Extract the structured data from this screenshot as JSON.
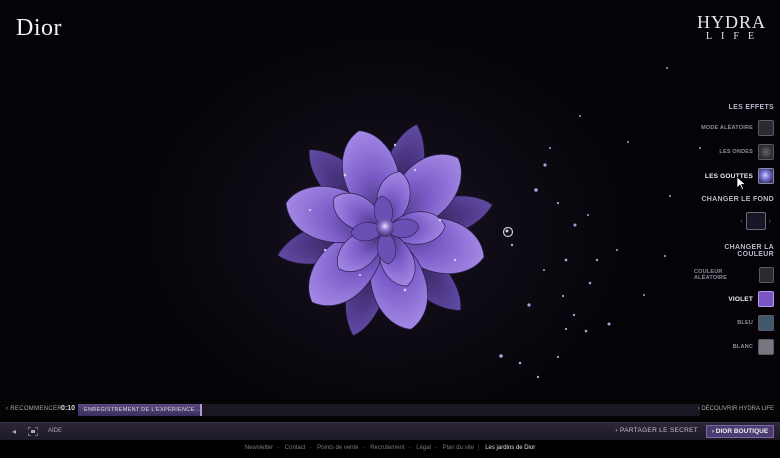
{
  "brand": {
    "logo": "Dior",
    "hydra_line1": "HYDRA",
    "hydra_line2": "LIFE"
  },
  "effects": {
    "title": "LES EFFETS",
    "items": [
      {
        "label": "MODE ALÉATOIRE",
        "active": false
      },
      {
        "label": "LES ONDES",
        "active": false
      },
      {
        "label": "LES GOUTTES",
        "active": true
      }
    ]
  },
  "background": {
    "title": "CHANGER LE FOND"
  },
  "colors": {
    "title": "CHANGER LA COULEUR",
    "items": [
      {
        "label": "COULEUR ALÉATOIRE",
        "active": false
      },
      {
        "label": "VIOLET",
        "active": true
      },
      {
        "label": "BLEU",
        "active": false
      },
      {
        "label": "BLANC",
        "active": false
      }
    ]
  },
  "timebar": {
    "restart_label": "RECOMMENCER",
    "time": "0:10",
    "status": "ENREGISTREMENT DE L'EXPÉRIENCE...",
    "progress": 0.197,
    "discover_label": "DÉCOUVRIR HYDRA LIFE"
  },
  "controlbar": {
    "help_label": "AIDE",
    "share_label": "PARTAGER LE SECRET",
    "boutique_label": "DIOR BOUTIQUE"
  },
  "footer": {
    "links": [
      "Newsletter",
      "Contact",
      "Points de vente",
      "Recrutement",
      "Légal",
      "Plan du site"
    ],
    "current": "Les jardins de Dior"
  },
  "accent_color": "#7a55c4"
}
